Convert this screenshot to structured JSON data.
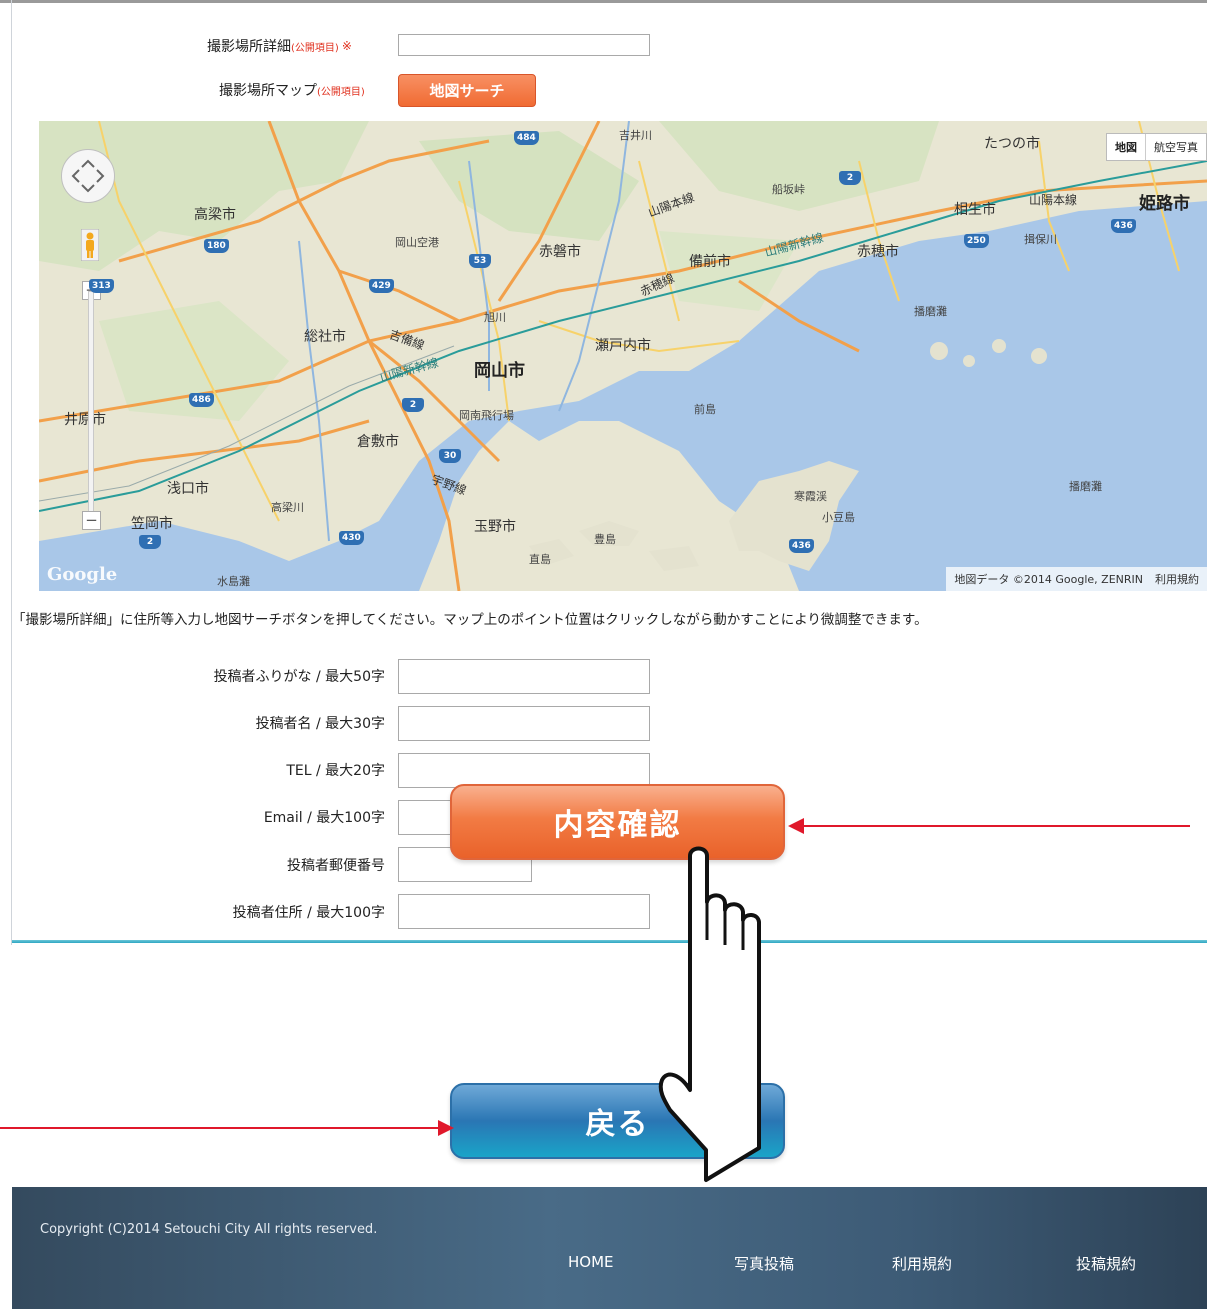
{
  "form_top": {
    "location_detail": {
      "label": "撮影場所詳細",
      "tag": "(公開項目)",
      "required": "※",
      "value": ""
    },
    "location_map": {
      "label": "撮影場所マップ",
      "tag": "(公開項目)",
      "button": "地図サーチ"
    }
  },
  "map": {
    "type_map": "地図",
    "type_satellite": "航空写真",
    "zoom_in": "+",
    "zoom_out": "−",
    "attribution": "地図データ ©2014 Google, ZENRIN",
    "terms": "利用規約",
    "logo": "Google",
    "places": {
      "okayama": "岡山市",
      "himeji": "姫路市",
      "tatsuno": "たつの市",
      "aioi": "相生市",
      "ako": "赤穂市",
      "bizen": "備前市",
      "akaiwa": "赤磐市",
      "setouchi": "瀬戸内市",
      "soja": "総社市",
      "takahashi": "高梁市",
      "kurashiki": "倉敷市",
      "asakuchi": "浅口市",
      "kasaoka": "笠岡市",
      "tamano": "玉野市",
      "ibara": "井原市",
      "shodoshima": "小豆島",
      "kankakei": "寒霞渓",
      "yoshii": "吉井川",
      "asahi": "旭川",
      "takahashigawa": "高梁川",
      "ibogawa": "揖保川",
      "okayama_airport": "岡山空港",
      "okayama_south_airport": "岡南飛行場",
      "funasaka": "船坂峠",
      "maejima": "前島",
      "teshima": "豊島",
      "naoshima": "直島",
      "harima_nada": "播磨灘",
      "harima_nada2": "播磨灘",
      "mizushima_nada": "水島灘"
    },
    "rails": {
      "sanyo_shinkansen": "山陽新幹線",
      "sanyo_shinkansen2": "山陽新幹線",
      "sanyo_line": "山陽本線",
      "sanyo_line2": "山陽本線",
      "ako_line": "赤穂線",
      "uno_line": "宇野線",
      "kibi_line": "吉備線"
    },
    "roads": [
      "484",
      "2",
      "180",
      "53",
      "429",
      "313",
      "250",
      "436",
      "486",
      "2",
      "30",
      "430",
      "2",
      "436"
    ]
  },
  "instruction": "「撮影場所詳細」に住所等入力し地図サーチボタンを押してください。マップ上のポイント位置はクリックしながら動かすことにより微調整できます。",
  "form_fields": [
    {
      "label": "投稿者ふりがな / 最大50字",
      "value": ""
    },
    {
      "label": "投稿者名 / 最大30字",
      "value": ""
    },
    {
      "label": "TEL / 最大20字",
      "value": ""
    },
    {
      "label": "Email / 最大100字",
      "value": ""
    },
    {
      "label": "投稿者郵便番号",
      "value": ""
    },
    {
      "label": "投稿者住所 / 最大100字",
      "value": ""
    }
  ],
  "buttons": {
    "confirm": "内容確認",
    "back": "戻る"
  },
  "footer": {
    "copyright": "Copyright (C)2014 Setouchi City All rights reserved.",
    "nav": [
      "HOME",
      "写真投稿",
      "利用規約",
      "投稿規約"
    ]
  },
  "colors": {
    "accent_orange": "#f27b44",
    "accent_blue": "#2a76b4",
    "annotation_red": "#e0182b"
  }
}
